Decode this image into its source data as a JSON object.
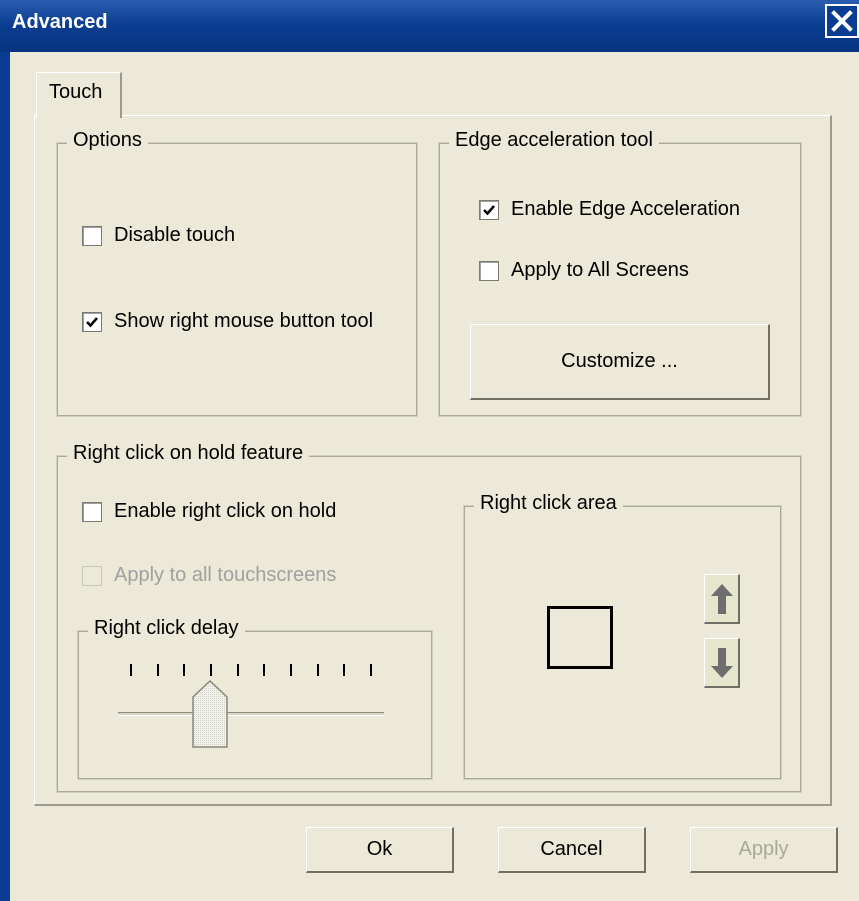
{
  "window": {
    "title": "Advanced"
  },
  "tabs": [
    {
      "label": "Touch",
      "selected": true
    }
  ],
  "options": {
    "title": "Options",
    "disable_touch": {
      "label": "Disable touch",
      "checked": false
    },
    "show_right_mouse": {
      "label": "Show right mouse button tool",
      "checked": true
    }
  },
  "edge": {
    "title": "Edge acceleration tool",
    "enable": {
      "label": "Enable Edge Acceleration",
      "checked": true
    },
    "apply_all": {
      "label": "Apply to All Screens",
      "checked": false
    },
    "customize_label": "Customize ..."
  },
  "right_click": {
    "title": "Right click on hold feature",
    "enable": {
      "label": "Enable right click on hold",
      "checked": false
    },
    "apply_all": {
      "label": "Apply to all touchscreens",
      "checked": false,
      "disabled": true
    },
    "delay": {
      "title": "Right click delay",
      "tick_count": 10,
      "value_index": 3
    },
    "area": {
      "title": "Right click area"
    }
  },
  "footer": {
    "ok_label": "Ok",
    "cancel_label": "Cancel",
    "apply_label": "Apply",
    "apply_disabled": true
  },
  "icons": {
    "close": "close-icon",
    "up": "arrow-up-icon",
    "down": "arrow-down-icon",
    "checkmark": "checkmark-icon"
  },
  "colors": {
    "titlebar": "#0a3d91",
    "dialog_bg": "#ece9d8",
    "disabled_text": "#a0a0a0"
  }
}
